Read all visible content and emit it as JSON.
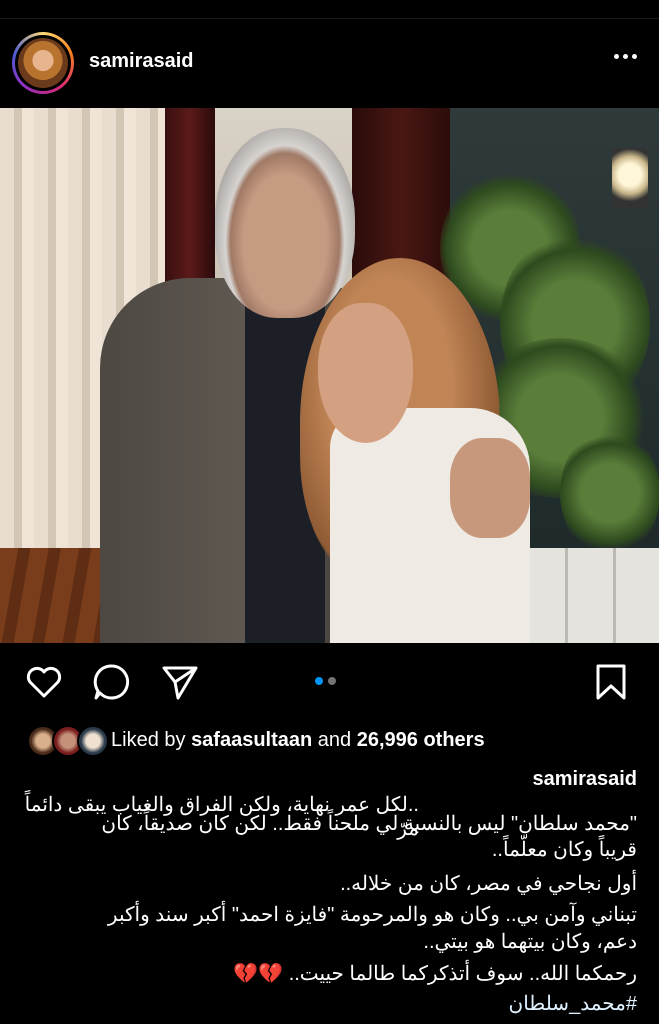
{
  "post": {
    "username": "samirasaid",
    "avatar_icon": "profile-avatar",
    "more_icon": "more-horizontal-icon"
  },
  "carousel": {
    "active_index": 0,
    "count": 2,
    "active_color": "#0095f6",
    "inactive_color": "#737373"
  },
  "actions": {
    "like_icon": "heart-icon",
    "comment_icon": "comment-icon",
    "share_icon": "send-icon",
    "save_icon": "bookmark-icon"
  },
  "likes": {
    "prefix": "Liked by",
    "user": "safaasultaan",
    "middle": "and",
    "count_text": "26,996 others"
  },
  "caption": {
    "line1_tail": "..لكل عمر نهاية، ولكن الفراق والغياب يبقى دائماً مرّ",
    "line2": "\"محمد سلطان\" ليس بالنسبة لي ملحناً فقط.. لكن كان صديقاً، كان",
    "line3": "قريباً وكان معلّماً..",
    "line4": "أول نجاحي في مصر، كان من خلاله..",
    "line5": "تبناني وآمن بي.. وكان هو والمرحومة \"فايزة احمد\" أكبر سند وأكبر",
    "line6": "دعم، وكان بيتهما هو بيتي..",
    "line7": "رحمكما الله.. سوف أتذكركما طالما حييت.. 💔💔",
    "hashtag": "#محمد_سلطان"
  }
}
